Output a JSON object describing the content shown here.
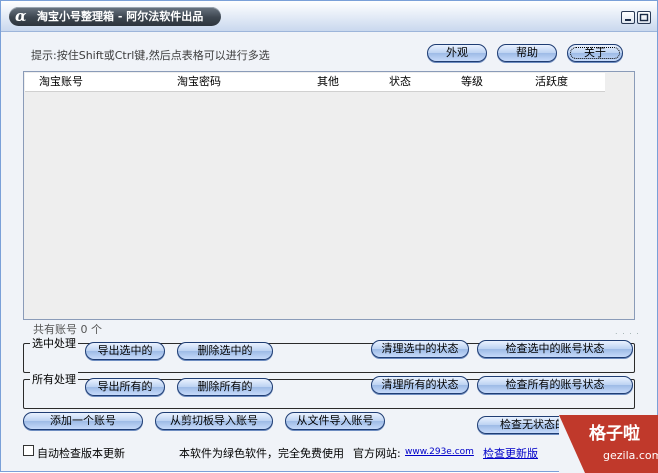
{
  "window": {
    "logo": "α",
    "title": "淘宝小号整理箱 - 阿尔法软件出品"
  },
  "hint": "提示:按住Shift或Ctrl键,然后点表格可以进行多选",
  "top_buttons": {
    "appearance": "外观",
    "help": "帮助",
    "about": "关于"
  },
  "table": {
    "columns": [
      "淘宝账号",
      "淘宝密码",
      "其他",
      "状态",
      "等级",
      "活跃度"
    ],
    "rows": []
  },
  "account_count": "共有账号 0 个",
  "selected_group": {
    "label": "选中处理",
    "export": "导出选中的",
    "delete": "删除选中的",
    "clear_status": "清理选中的状态",
    "check_status": "检查选中的账号状态"
  },
  "all_group": {
    "label": "所有处理",
    "export": "导出所有的",
    "delete": "删除所有的",
    "clear_status": "清理所有的状态",
    "check_status": "检查所有的账号状态"
  },
  "bottom_buttons": {
    "add_one": "添加一个账号",
    "import_clipboard": "从剪切板导入账号",
    "import_file": "从文件导入账号",
    "check_no_status": "检查无状态的账号状态"
  },
  "footer": {
    "auto_update_label": "自动检查版本更新",
    "auto_update_checked": false,
    "free_notice": "本软件为绿色软件，完全免费使用",
    "site_label": "官方网站:",
    "site_link": "www.293e.com",
    "check_update_link": "检查更新版"
  },
  "watermark": {
    "cn": "格子啦",
    "en": "gezila.com"
  },
  "colors": {
    "title_pill": "#3d4650",
    "button_face": "#bcd2f2",
    "button_border": "#1f3d73",
    "window_bg": "#f0f3f8",
    "link": "#0000c8",
    "watermark": "#c0392b"
  }
}
